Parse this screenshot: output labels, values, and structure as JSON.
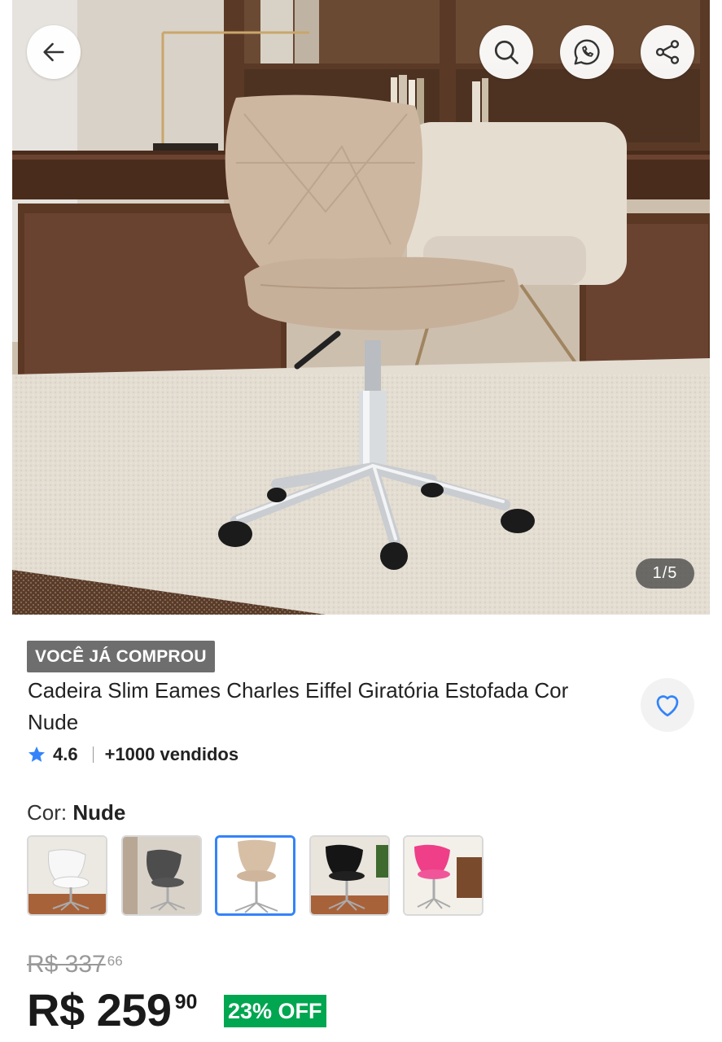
{
  "gallery": {
    "counter": "1/5",
    "image_description_alt": "Cadeira Slim Eames Charles Eiffel Giratória Estofada Cor Nude"
  },
  "top_actions": {
    "back_icon": "arrow-left-icon",
    "search_icon": "search-icon",
    "whatsapp_icon": "whatsapp-icon",
    "share_icon": "share-icon"
  },
  "product": {
    "badge": "VOCÊ JÁ COMPROU",
    "title": "Cadeira Slim Eames Charles Eiffel Giratória Estofada Cor Nude",
    "rating": "4.6",
    "sold": "+1000 vendidos",
    "favorite_icon": "heart-icon"
  },
  "variants": {
    "label": "Cor:",
    "selected": "Nude",
    "options": [
      {
        "color": "#f4f4f4"
      },
      {
        "color": "#4d4d4d"
      },
      {
        "color": "#d7bfa6"
      },
      {
        "color": "#151515"
      },
      {
        "color": "#ee3f88"
      }
    ],
    "selected_index": 2
  },
  "pricing": {
    "old_price": "R$ 337",
    "old_cents": "66",
    "price": "R$ 259",
    "cents": "90",
    "discount": "23% OFF"
  },
  "colors": {
    "accent": "#3483fa",
    "discount_bg": "#00a650",
    "badge_bg": "#6e6e6e"
  }
}
